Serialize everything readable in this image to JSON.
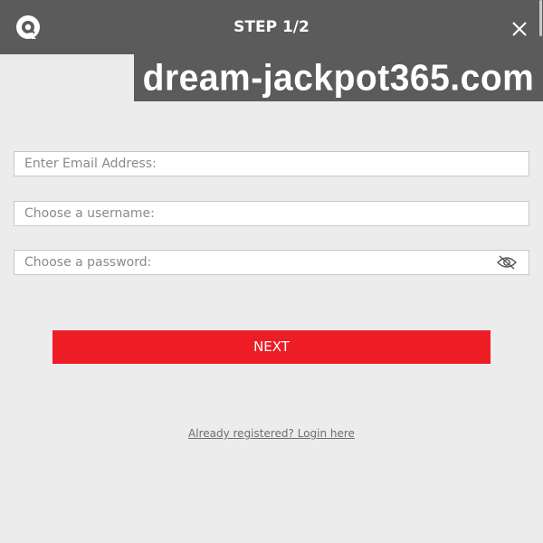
{
  "header": {
    "title": "STEP 1/2",
    "logo_icon": "chat-q-logo-icon",
    "close_icon": "close-icon"
  },
  "watermark": {
    "text": "dream-jackpot365.com"
  },
  "form": {
    "email": {
      "value": "",
      "placeholder": "Enter Email Address:"
    },
    "username": {
      "value": "",
      "placeholder": "Choose a username:"
    },
    "password": {
      "value": "",
      "placeholder": "Choose a password:",
      "toggle_icon": "eye-slash-icon"
    }
  },
  "actions": {
    "next_label": "NEXT",
    "login_link": "Already registered? Login here"
  },
  "colors": {
    "header_bg": "#5b5b5b",
    "page_bg": "#ececec",
    "accent": "#ee1c25"
  }
}
